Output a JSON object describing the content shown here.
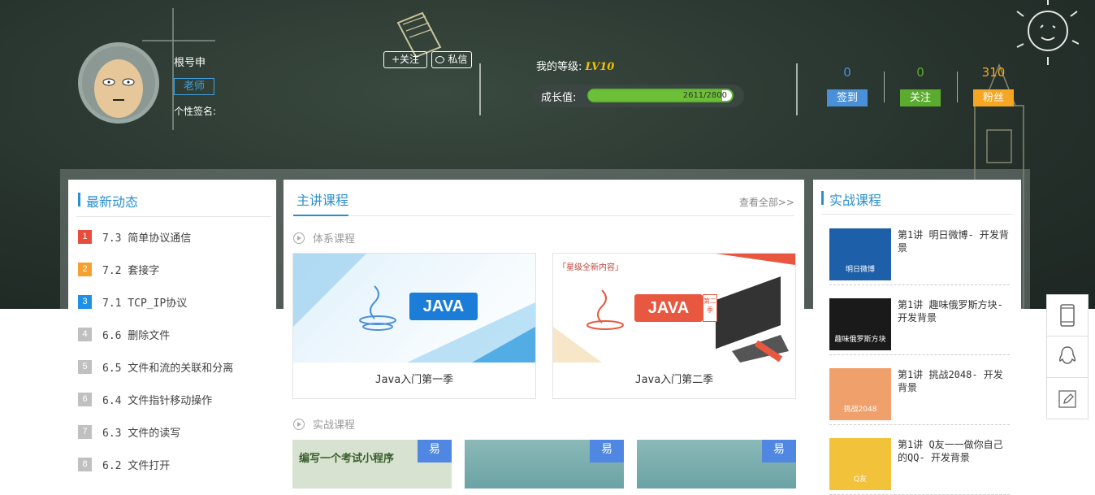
{
  "profile": {
    "name": "根号申",
    "role": "老师",
    "signature_label": "个性签名:",
    "follow_label": "+关注",
    "message_label": "私信"
  },
  "level": {
    "label": "我的等级:",
    "value": "LV10"
  },
  "growth": {
    "label": "成长值:",
    "current": 2611,
    "max": 2800,
    "text": "2611/2800"
  },
  "stats": [
    {
      "count": "0",
      "label": "签到",
      "color": "#4a90d9"
    },
    {
      "count": "0",
      "label": "关注",
      "color": "#5aab2e"
    },
    {
      "count": "310",
      "label": "粉丝",
      "color": "#f5a623"
    }
  ],
  "recent": {
    "title": "最新动态",
    "items": [
      {
        "num": "1",
        "text": "7.3 简单协议通信",
        "color": "#e84c3d"
      },
      {
        "num": "2",
        "text": "7.2 套接字",
        "color": "#f5a030"
      },
      {
        "num": "3",
        "text": "7.1 TCP_IP协议",
        "color": "#1e90e8"
      },
      {
        "num": "4",
        "text": "6.6 删除文件",
        "color": "#c0c0c0"
      },
      {
        "num": "5",
        "text": "6.5 文件和流的关联和分离",
        "color": "#c0c0c0"
      },
      {
        "num": "6",
        "text": "6.4 文件指针移动操作",
        "color": "#c0c0c0"
      },
      {
        "num": "7",
        "text": "6.3 文件的读写",
        "color": "#c0c0c0"
      },
      {
        "num": "8",
        "text": "6.2 文件打开",
        "color": "#c0c0c0"
      }
    ]
  },
  "main": {
    "tab": "主讲课程",
    "view_all": "查看全部>>",
    "system_section": "体系课程",
    "practice_section": "实战课程",
    "courses": [
      {
        "name": "Java入门第一季",
        "logo": "JAVA"
      },
      {
        "name": "Java入门第二季",
        "logo": "JAVA",
        "banner": "「星级全新内容」",
        "tag": "第二季"
      }
    ],
    "practice_thumbs": [
      {
        "badge": "易",
        "caption": "编写一个考试小程序"
      },
      {
        "badge": "易"
      },
      {
        "badge": "易"
      }
    ]
  },
  "practice": {
    "title": "实战课程",
    "items": [
      {
        "text": "第1讲 明日微博- 开发背景",
        "thumb_text": "明日微博",
        "thumb_color": "#1d5fa8"
      },
      {
        "text": "第1讲 趣味俄罗斯方块- 开发背景",
        "thumb_text": "趣味俄罗斯方块",
        "thumb_color": "#1a1a1a"
      },
      {
        "text": "第1讲 挑战2048- 开发背景",
        "thumb_text": "挑战2048",
        "thumb_color": "#f0a06a"
      },
      {
        "text": "第1讲 Q友一一做你自己的QQ- 开发背景",
        "thumb_text": "Q友",
        "thumb_color": "#f2c23a"
      }
    ]
  },
  "sidebar": {
    "icons": [
      "phone-icon",
      "qq-icon",
      "edit-icon"
    ]
  }
}
